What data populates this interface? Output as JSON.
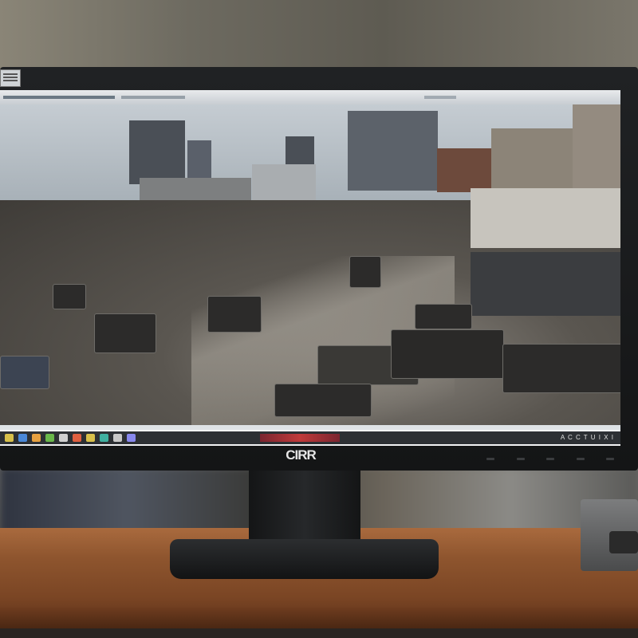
{
  "monitor": {
    "brand_logo": "CIRR"
  },
  "screen": {
    "taskbar": {
      "status_text": "",
      "tray_text": "A C C T U I X I"
    }
  },
  "colors": {
    "desk": "#8e552e",
    "bezel": "#1a1b1c",
    "taskbar": "#2d3034"
  },
  "icons": [
    "app-menu-icon",
    "taskbar-app-icons",
    "tray-status-icons"
  ]
}
